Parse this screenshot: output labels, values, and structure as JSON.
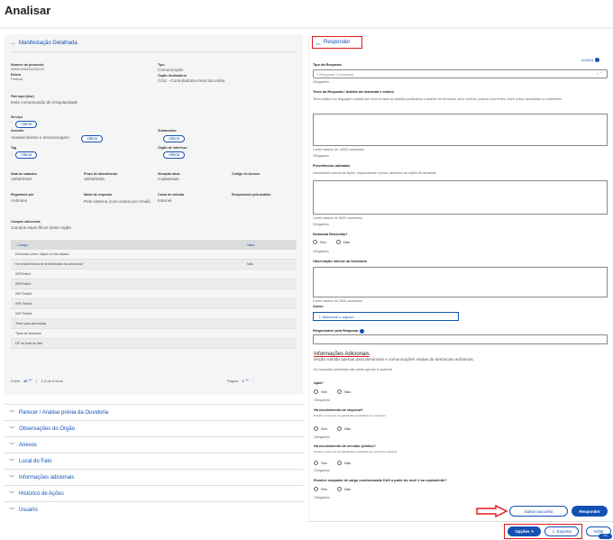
{
  "page_title": "Analisar",
  "left": {
    "section_title": "Manifestação Detalhada",
    "fields": [
      {
        "label": "Número do protocolo",
        "value": "99999.000432/2020-61"
      },
      {
        "label": "Esfera",
        "value": "Federal"
      },
      {
        "label": "Tipo",
        "value": "Comunicação"
      },
      {
        "label": "Órgão destinatário",
        "value": "CGU - Controladoria-Geral da União"
      },
      {
        "label": "Fale aqui (teor)",
        "value": "teste comunicação de irregularidade"
      },
      {
        "label": "Serviço",
        "value": "-"
      },
      {
        "label": "Assunto",
        "value": "Abastecimento e armazenagem"
      },
      {
        "label": "Subassunto",
        "value": "-"
      },
      {
        "label": "Tag",
        "value": "-"
      },
      {
        "label": "Órgão de interesse",
        "value": "-"
      },
      {
        "label": "Data de cadastro",
        "value": "19/08/2026"
      },
      {
        "label": "Prazo de atendimento",
        "value": "18/09/2026"
      },
      {
        "label": "Situação atual",
        "value": "Cadastrada"
      },
      {
        "label": "Código de Acesso",
        "value": "-"
      },
      {
        "label": "Registrado por",
        "value": "Anônimo"
      },
      {
        "label": "Modo de resposta",
        "value": "Pelo sistema (com avisos por email)"
      },
      {
        "label": "Canal de entrada",
        "value": "Internet"
      },
      {
        "label": "Responsável pela análise",
        "value": ""
      },
      {
        "label": "Campos adicionais",
        "value": "Campos específicos deste órgão"
      }
    ],
    "alter": "Alterar",
    "table": {
      "col_campo": "Campo",
      "col_valor": "Valor",
      "rows": [
        {
          "campo": "Denuncia crime: clique no link abaixo",
          "valor": ""
        },
        {
          "campo": "Há envolvimento de terceirizados na denuncia?",
          "valor": "Não"
        },
        {
          "campo": "INFITeste1",
          "valor": ""
        },
        {
          "campo": "INFITeste2",
          "valor": ""
        },
        {
          "campo": "INFI Teste3",
          "valor": ""
        },
        {
          "campo": "INFI Teste4",
          "valor": ""
        },
        {
          "campo": "INFI Teste5",
          "valor": ""
        },
        {
          "campo": "Teste para denuncias",
          "valor": ""
        },
        {
          "campo": "Tipos de Usuarios",
          "valor": ""
        },
        {
          "campo": "UF do local do fato",
          "valor": ""
        }
      ]
    },
    "pager": {
      "exibir": "Exibir",
      "per_page": "10",
      "range": "1-3 de 8 itens",
      "pagina": "Página",
      "page": "1"
    },
    "collapsed": [
      "Parecer / Análise prévia da Ouvidoria",
      "Observações do Órgão",
      "Anexos",
      "Local do Fato",
      "Informações adicionais",
      "Histórico de Ações",
      "Usuário"
    ]
  },
  "right": {
    "responder": "Responder",
    "ajuda": "AJUDA",
    "tipo_label": "Tipo da Resposta",
    "tipo_placeholder": "Resposta Conclusiva",
    "obrigatorio": "Obrigatório",
    "texto_label": "Texto da Resposta / Análise da demanda e motivo",
    "texto_hint": "Texto público em linguagem cidadã que será enviado ao cidadão justificando a análise da demanda, seus motivos, prazos recorrentes, entre outros apontados no tratamento.",
    "limite_14000": "Limite máximo de 14000 caracteres",
    "prov_label": "Providências adotadas",
    "prov_hint": "Informações acerca de ações, responsáveis e prazo, atinentes ao objeto da demanda",
    "limite_5000": "Limite máximo de 5000 caracteres",
    "demanda_label": "Demanda Resolvida?",
    "sim": "Sim",
    "nao": "Não",
    "obs_label": "Observação interna da Ouvidoria",
    "limite_2000": "Limite máximo de 2000 caracteres",
    "anexo_label": "Anexo",
    "anexo_btn": "Selecione o arquivo",
    "resp_label": "Responsável pela Resposta",
    "info_title": "Informações Adicionais",
    "info_sub": "Seção exibida apenas para denúncias e comunicações vindas da denúncias anônimas.",
    "info_note": "As respostas publicadas são vistas apenas à ouvidoria",
    "q1": "Apta?",
    "q2": "Há envolvimento de empresa?",
    "q2_hint": "Exibido mostrar de irregularidades praticadas por empresas",
    "q3": "Há envolvimento de servidor público?",
    "q3_hint": "Exibido mostrar de irregularidades praticadas por servidores públicos",
    "q4": "Envolve ocupante de cargo comissionado DAS a partir do nível 4 ou equivalente?",
    "salvar": "Salvar rascunho",
    "responder_btn": "Responder",
    "opcoes": "Opções",
    "exportar": "Exportar",
    "voltar": "Voltar",
    "badge": "1/1"
  },
  "colors": {
    "accent": "#1351b4",
    "highlight": "#e01a1a",
    "panel": "#f5f5f5"
  }
}
